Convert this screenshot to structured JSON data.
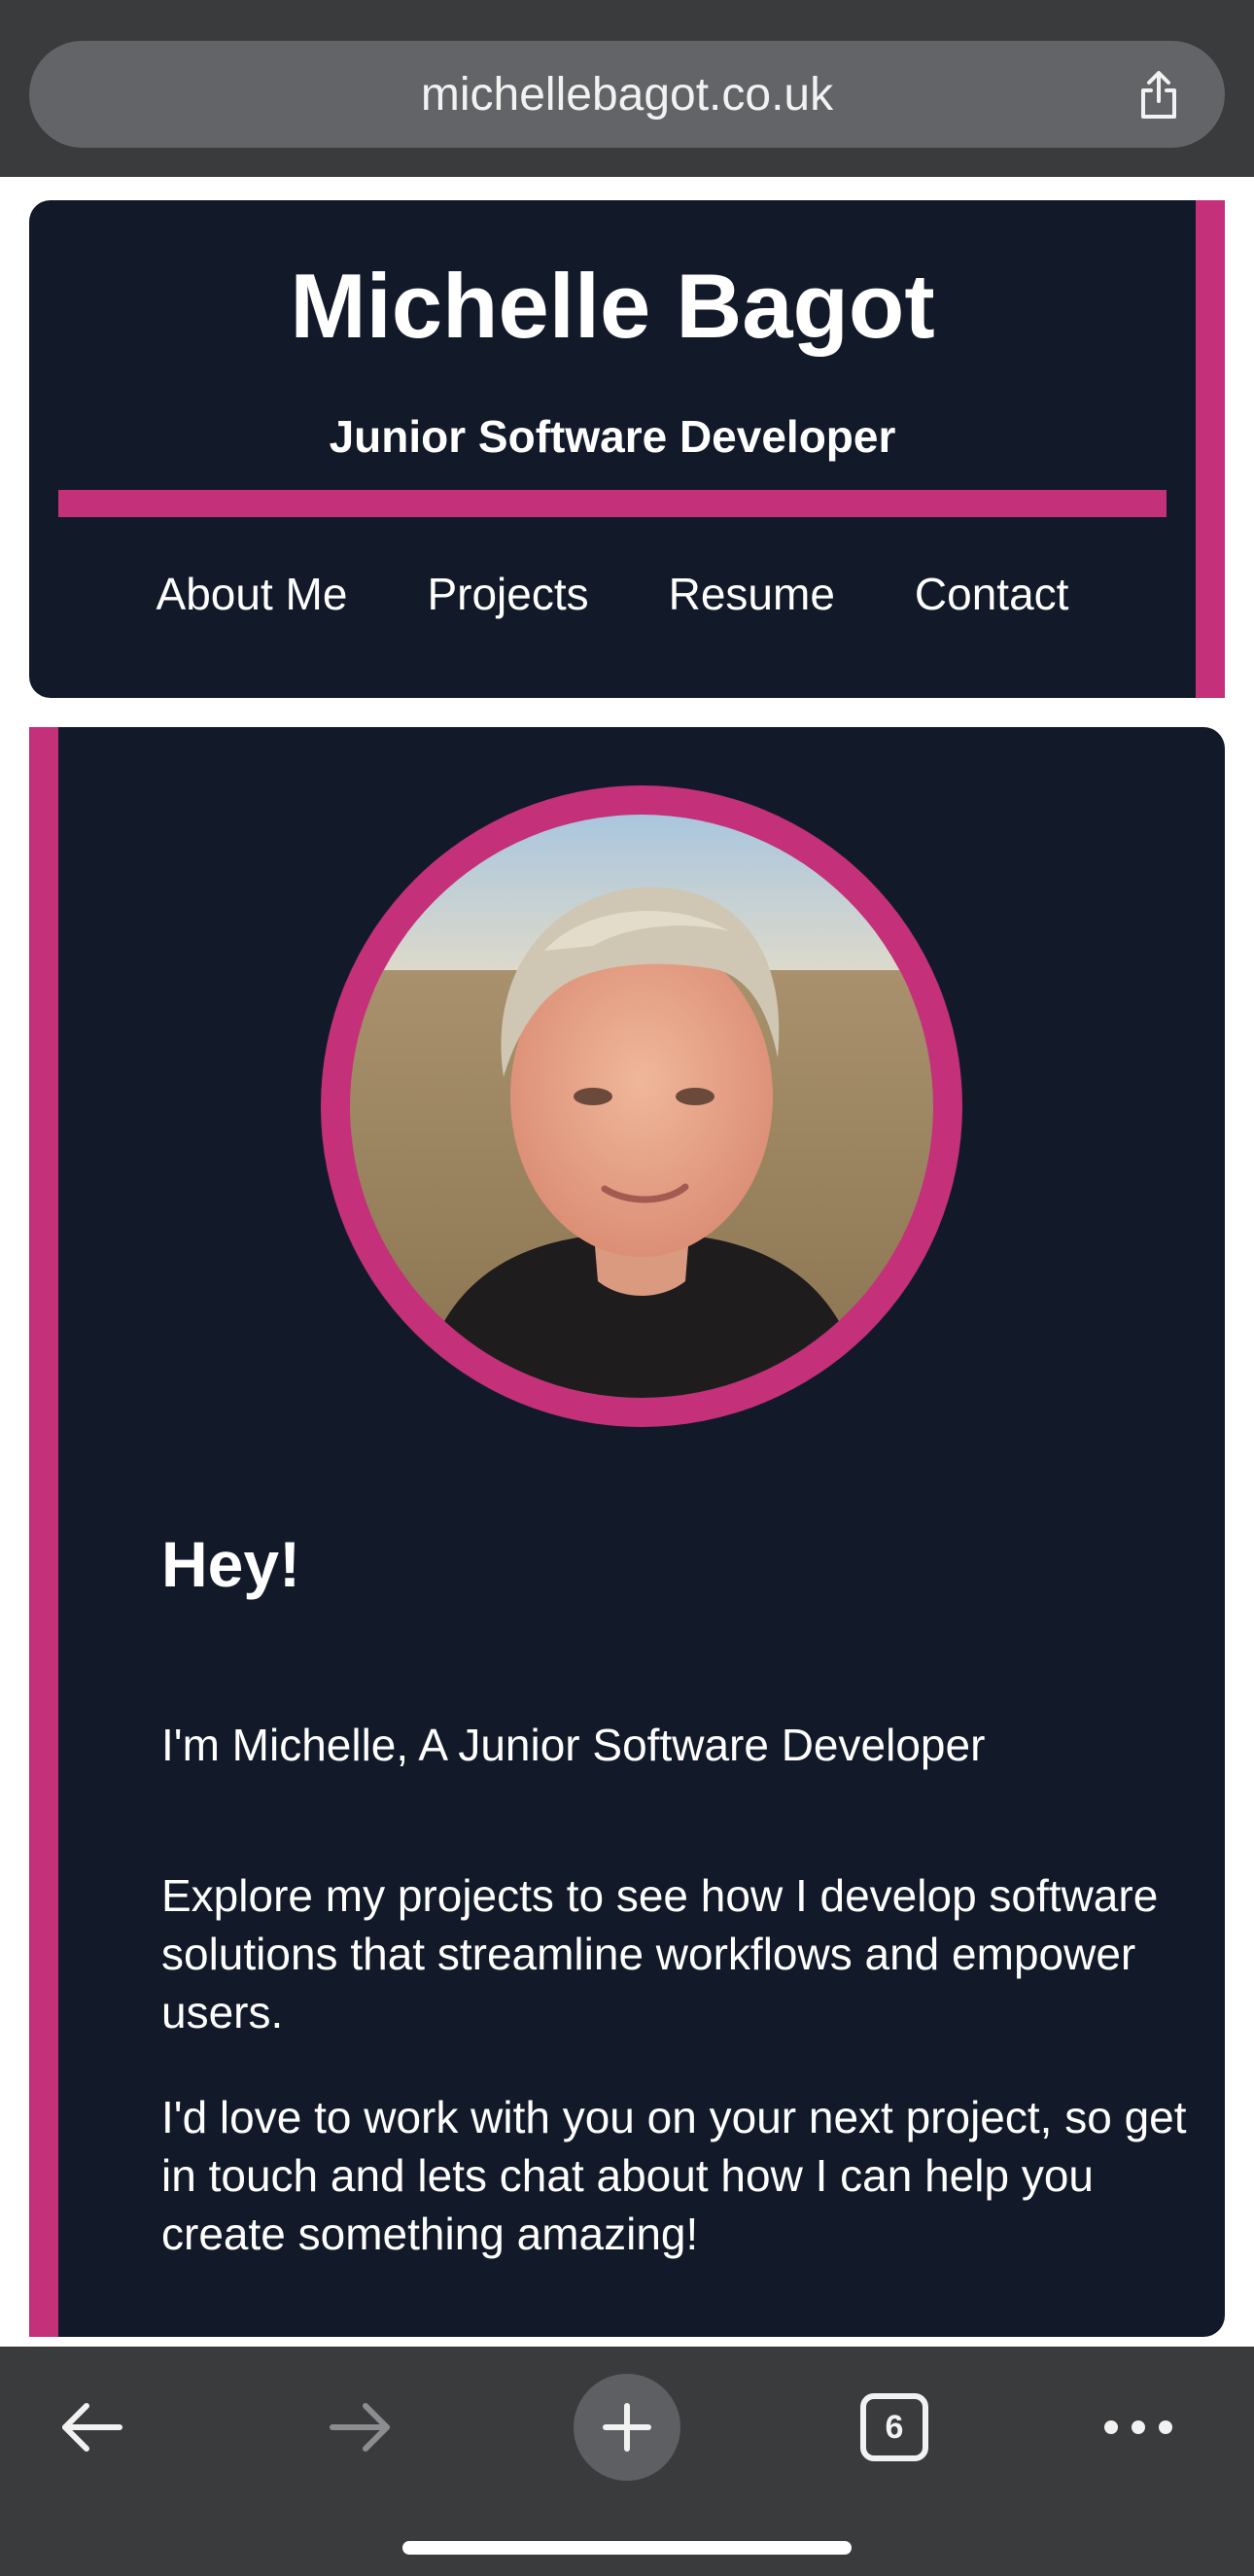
{
  "colors": {
    "accent": "#c4307a",
    "card_bg": "#121a2a",
    "browser_chrome": "#3a3b3d"
  },
  "browser": {
    "url": "michellebagot.co.uk",
    "share_icon": "share-icon",
    "tab_count": "6",
    "toolbar_icons": [
      "back-arrow-icon",
      "forward-arrow-icon",
      "plus-icon",
      "tabs-icon",
      "more-icon"
    ]
  },
  "header": {
    "name": "Michelle Bagot",
    "role": "Junior Software Developer",
    "nav": [
      {
        "label": "About Me"
      },
      {
        "label": "Projects"
      },
      {
        "label": "Resume"
      },
      {
        "label": "Contact"
      }
    ]
  },
  "main": {
    "greeting": "Hey!",
    "intro": "I'm Michelle, A Junior Software Developer",
    "paragraph1": "Explore my projects to see how I develop software solutions that streamline workflows and empower users.",
    "paragraph2": "I'd love to work with you on your next project, so get in touch and lets chat about how I can help you create something amazing!"
  }
}
